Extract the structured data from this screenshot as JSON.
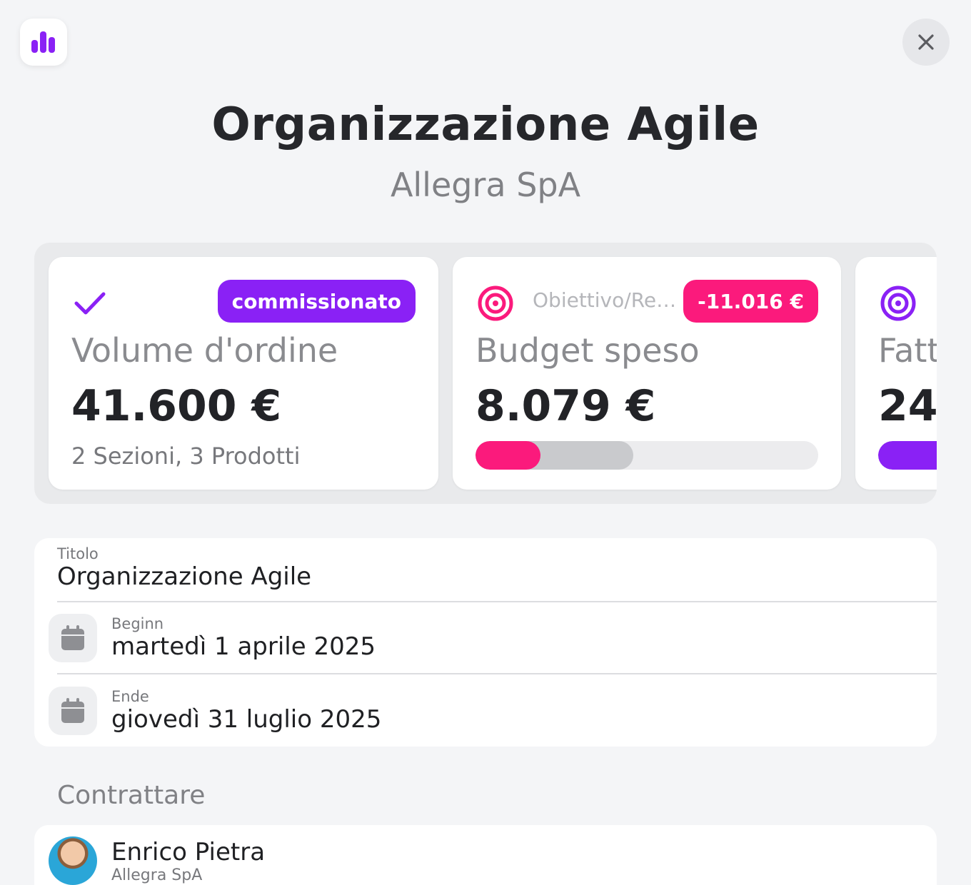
{
  "header": {
    "app_icon": "bar-chart-icon",
    "close_icon": "close-icon",
    "title": "Organizzazione Agile",
    "subtitle": "Allegra SpA"
  },
  "cards": [
    {
      "icon": "checkmark-icon",
      "badge": "commissionato",
      "badge_color": "#8a21f5",
      "name": "Volume d'ordine",
      "value": "41.600 €",
      "note": "2 Sezioni, 3 Prodotti"
    },
    {
      "icon": "target-icon",
      "label": "Obiettivo/Re…",
      "badge": "-11.016 €",
      "badge_color": "#fb1a7c",
      "name": "Budget speso",
      "value": "8.079 €",
      "progress_fraction": 0.19,
      "target_fraction": 0.46
    },
    {
      "icon": "target-icon",
      "name": "Fatt",
      "value": "24.",
      "progress_color": "#8a21f5"
    }
  ],
  "form": {
    "title_label": "Titolo",
    "title_value": "Organizzazione Agile",
    "start_label": "Beginn",
    "start_value": "martedì 1 aprile 2025",
    "end_label": "Ende",
    "end_value": "giovedì 31 luglio 2025",
    "calendar_icon": "calendar-icon"
  },
  "contact_section": {
    "heading": "Contrattare",
    "name": "Enrico Pietra",
    "company": "Allegra SpA"
  },
  "colors": {
    "accent_purple": "#8a21f5",
    "accent_pink": "#fb1a7c",
    "background": "#f4f5f7"
  }
}
